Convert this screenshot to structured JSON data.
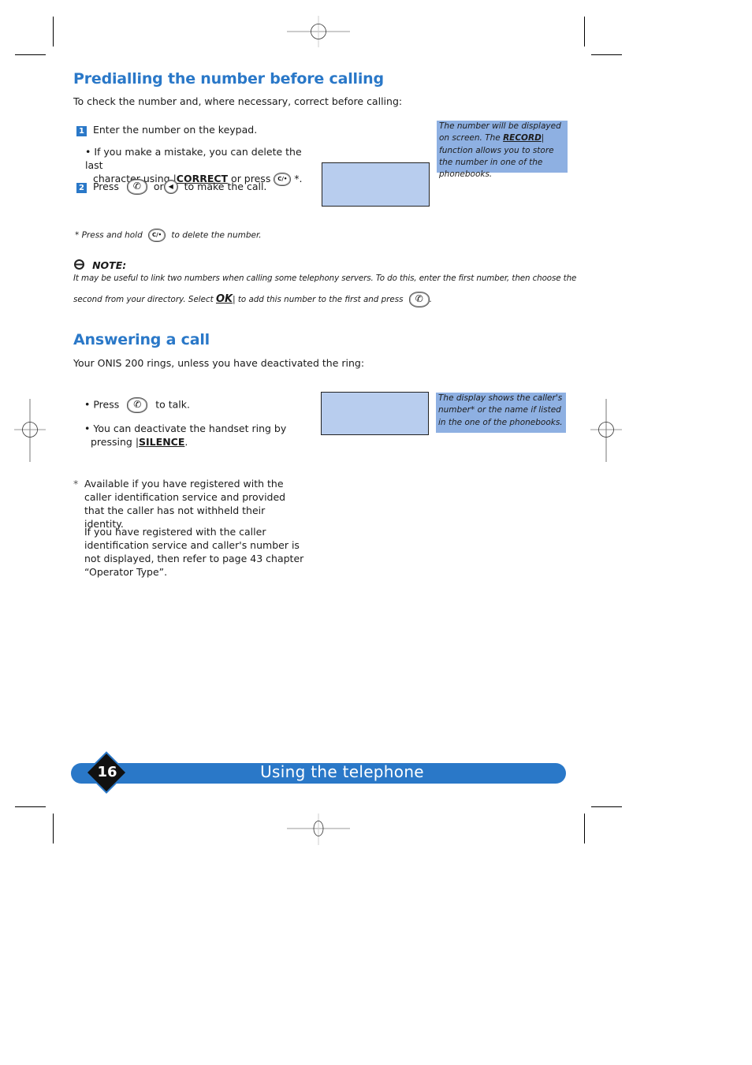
{
  "section1": {
    "title": "Predialling the number before calling",
    "intro": "To check the number and, where necessary, correct before calling:",
    "step1_num": "1",
    "step1_text": "Enter the number on the keypad.",
    "bullet_a": "• If you make a mistake, you can delete the last",
    "bullet_b_pre": "character using |",
    "bullet_b_key": "CORRECT",
    "bullet_b_mid": " or press",
    "bullet_b_post": " *.",
    "step2_num": "2",
    "step2_pre": "Press",
    "step2_or": "or",
    "step2_post": "to make the call.",
    "side_note_a": "The number will be displayed on screen. The ",
    "side_note_key": "RECORD",
    "side_note_b": "| function allows you to store the number in one of the phonebooks.",
    "footnote_pre": "* Press and hold",
    "footnote_post": "to delete the number."
  },
  "note": {
    "label": "NOTE:",
    "line1": "It may be useful to link two numbers when calling some telephony servers. To do this, enter the first number, then choose the",
    "line2_pre": "second from your directory. Select ",
    "line2_key": "OK",
    "line2_mid": "| to add this number to the first and press",
    "line2_post": "."
  },
  "section2": {
    "title": "Answering a call",
    "intro": "Your ONIS 200 rings, unless you have deactivated the ring:",
    "bullet1_pre": "• Press",
    "bullet1_post": "to talk.",
    "bullet2_a": "• You can deactivate the handset ring by",
    "bullet2_b_pre": "pressing |",
    "bullet2_b_key": "SILENCE",
    "bullet2_b_post": ".",
    "side_note": "The display shows the caller's number* or the name if listed in the one of the phonebooks.",
    "foot_star": "*",
    "foot_p1": "Available if you have registered with the caller identification service and provided that the caller has not withheld their identity.",
    "foot_p2": "If you have registered with the caller identification service and caller's number is not displayed, then refer to page 43 chapter “Operator Type”."
  },
  "footer": {
    "page_number": "16",
    "chapter_title": "Using the telephone"
  },
  "icons": {
    "call": "✆",
    "speaker": "◀",
    "correct": "C/•"
  },
  "colors": {
    "accent": "#2a78c8",
    "note_bg": "#8eb0e2",
    "screen_bg": "#b8cdee"
  }
}
